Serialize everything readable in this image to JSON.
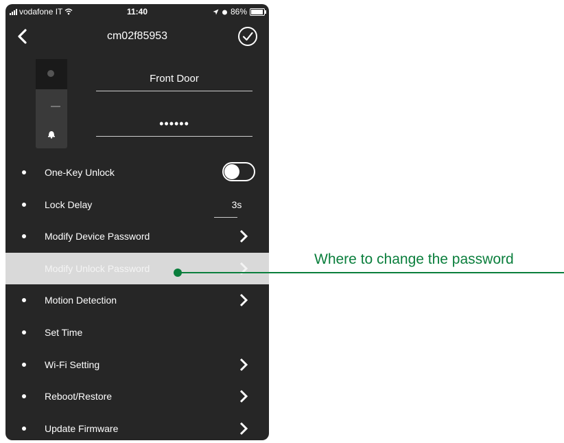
{
  "status_bar": {
    "carrier": "vodafone IT",
    "time": "11:40",
    "battery": "86%"
  },
  "nav": {
    "title": "cm02f85953"
  },
  "device": {
    "name": "Front Door",
    "password_mask": "••••••"
  },
  "menu": {
    "items": [
      {
        "label": "One-Key Unlock",
        "control": "toggle",
        "toggle_on": false
      },
      {
        "label": "Lock Delay",
        "control": "value",
        "value": "3s"
      },
      {
        "label": "Modify Device Password",
        "control": "chevron"
      },
      {
        "label": "Modify Unlock Password",
        "control": "chevron",
        "highlighted": true
      },
      {
        "label": "Motion Detection",
        "control": "chevron"
      },
      {
        "label": "Set Time",
        "control": "none"
      },
      {
        "label": "Wi-Fi Setting",
        "control": "chevron"
      },
      {
        "label": "Reboot/Restore",
        "control": "chevron"
      },
      {
        "label": "Update Firmware",
        "control": "chevron"
      }
    ]
  },
  "annotation": {
    "text": "Where to change the password",
    "color": "#0a7e3c"
  },
  "colors": {
    "background": "#262626",
    "highlight": "#d9d9d9"
  }
}
